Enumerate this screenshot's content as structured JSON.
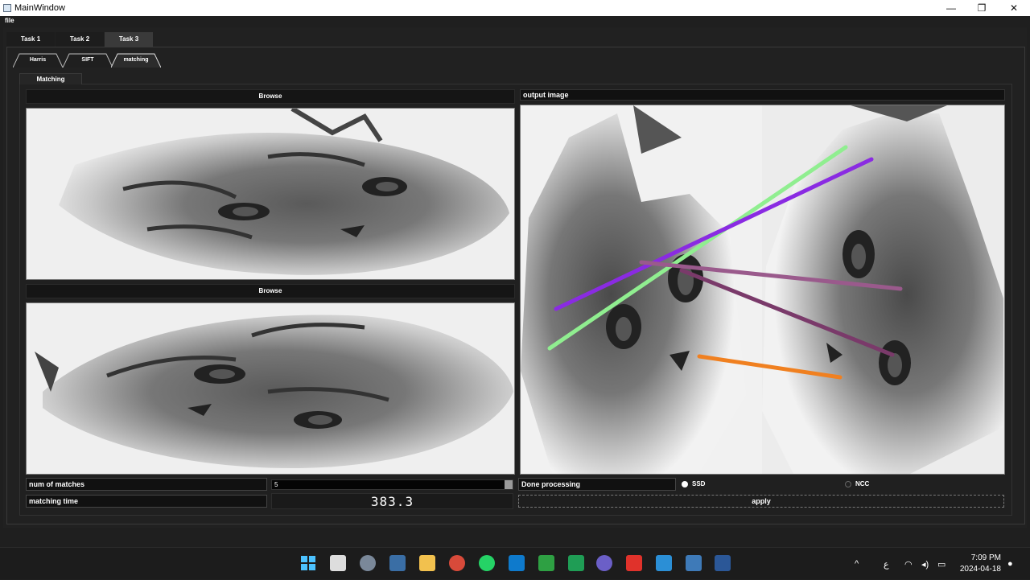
{
  "window": {
    "title": "MainWindow",
    "minimize": "—",
    "maximize": "❐",
    "close": "✕"
  },
  "menu": {
    "file": "file"
  },
  "task_tabs": [
    "Task 1",
    "Task 2",
    "Task 3"
  ],
  "sub_tabs": [
    "Harris",
    "SIFT",
    "matching"
  ],
  "inner_tab": "Matching",
  "left": {
    "browse1": "Browse",
    "browse2": "Browse"
  },
  "right": {
    "output_label": "output image"
  },
  "controls": {
    "num_matches_label": "num of matches",
    "num_matches_value": "5",
    "matching_time_label": "matching time",
    "matching_time_value": "383.3",
    "status": "Done processing",
    "ssd": "SSD",
    "ncc": "NCC",
    "apply": "apply"
  },
  "colors": {
    "accent": "#3a3a3a",
    "match1": "#90ee90",
    "match2": "#8a2be2",
    "match3": "#8e4a7e",
    "match4": "#7a3a6a",
    "match5": "#f08020"
  },
  "taskbar": {
    "icons": [
      "windows-start-icon",
      "file-explorer-icon",
      "settings-icon",
      "monitor-icon",
      "folder-icon",
      "chrome-icon",
      "whatsapp-icon",
      "vscode-icon",
      "app-green-icon",
      "excel-icon",
      "app-purple-icon",
      "acrobat-icon",
      "paint-icon",
      "python-icon",
      "word-icon"
    ],
    "lang": "ع",
    "time": "7:09 PM",
    "date": "2024-04-18"
  }
}
